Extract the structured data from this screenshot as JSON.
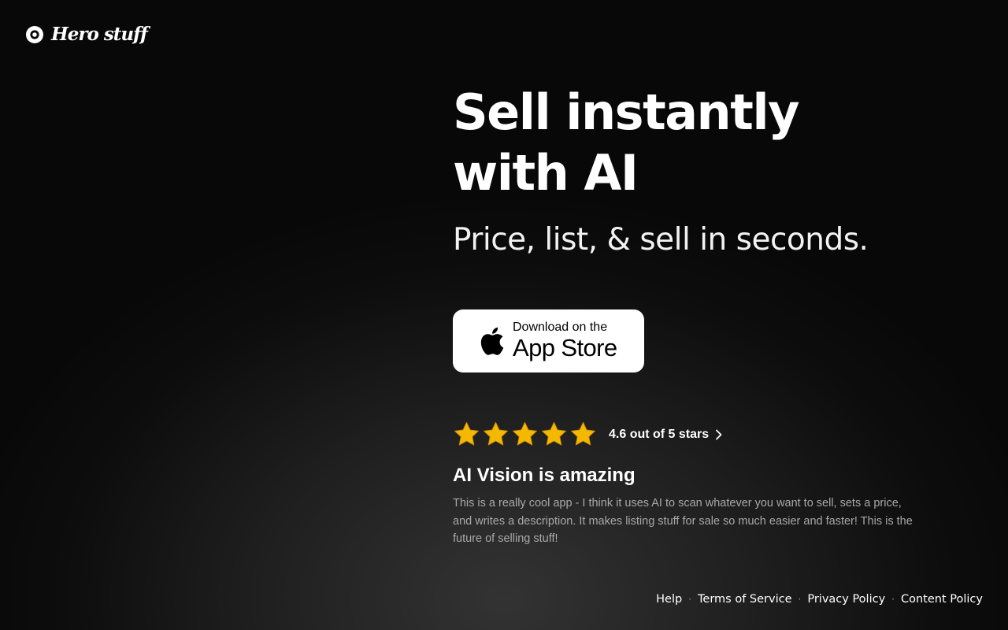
{
  "brand": {
    "name": "Hero stuff",
    "logo_icon": "eye-ring-icon"
  },
  "hero": {
    "headline_line1": "Sell instantly",
    "headline_line2": "with AI",
    "subheadline": "Price, list, & sell in seconds."
  },
  "app_store_button": {
    "small_text": "Download on the",
    "big_text": "App Store",
    "icon": "apple-icon"
  },
  "rating": {
    "stars": 5,
    "text": "4.6 out of 5 stars",
    "star_color": "#f5b800",
    "icon": "chevron-right-icon"
  },
  "review": {
    "title": "AI Vision is amazing",
    "body": "This is a really cool app - I think it uses AI to scan whatever you want to sell, sets a price, and writes a description. It makes listing stuff for sale so much easier and faster! This is the future of selling stuff!"
  },
  "footer": {
    "links": [
      "Help",
      "Terms of Service",
      "Privacy Policy",
      "Content Policy"
    ],
    "separator": "·"
  },
  "colors": {
    "background": "#111111",
    "text": "#ffffff",
    "muted_text": "#a8a8a8",
    "button_bg": "#ffffff"
  }
}
